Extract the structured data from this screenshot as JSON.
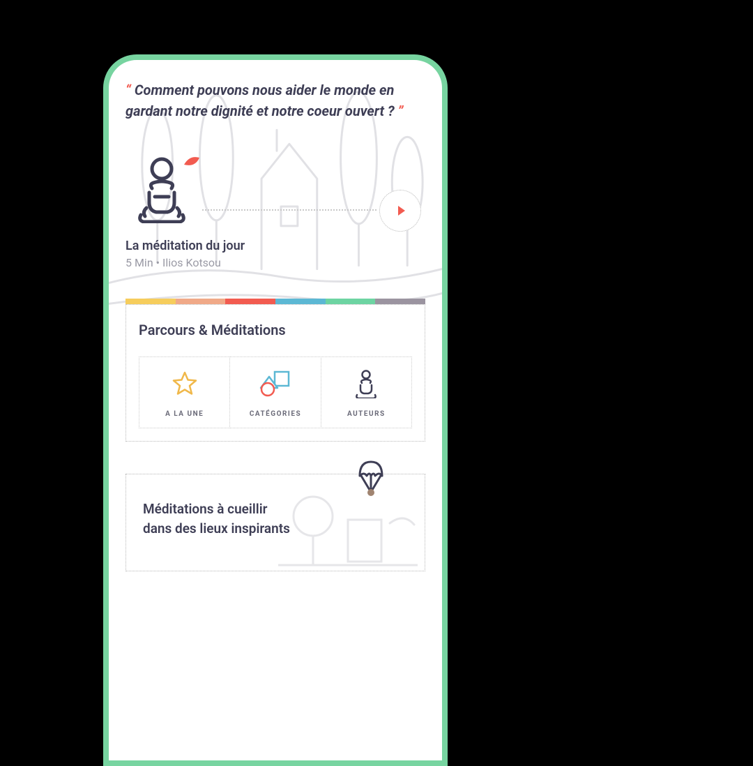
{
  "quote": {
    "open_mark": "“",
    "text": "Comment pouvons nous aider le monde en gardant notre dignité et notre coeur ouvert ?",
    "close_mark": "”"
  },
  "dailyMeditation": {
    "title": "La méditation du jour",
    "duration": "5 Min",
    "separator": " • ",
    "author": "Ilios Kotsou"
  },
  "parcours": {
    "title": "Parcours & Méditations",
    "stripColors": [
      "#f6cd5c",
      "#f0a988",
      "#f25b50",
      "#5cb8d4",
      "#6dd4a2",
      "#9b94a0"
    ],
    "categories": [
      {
        "label": "A LA UNE",
        "icon": "star"
      },
      {
        "label": "CATÉGORIES",
        "icon": "shapes"
      },
      {
        "label": "AUTEURS",
        "icon": "meditation"
      }
    ]
  },
  "locations": {
    "title_line1": "Méditations à cueillir",
    "title_line2": "dans des lieux inspirants"
  },
  "colors": {
    "accent": "#f25b50",
    "frame": "#77d4a0",
    "textDark": "#3e3e55",
    "textMuted": "#9a9aa5",
    "starStroke": "#f0b84a",
    "circleStroke": "#f25b50",
    "squareStroke": "#5cb8d4"
  }
}
